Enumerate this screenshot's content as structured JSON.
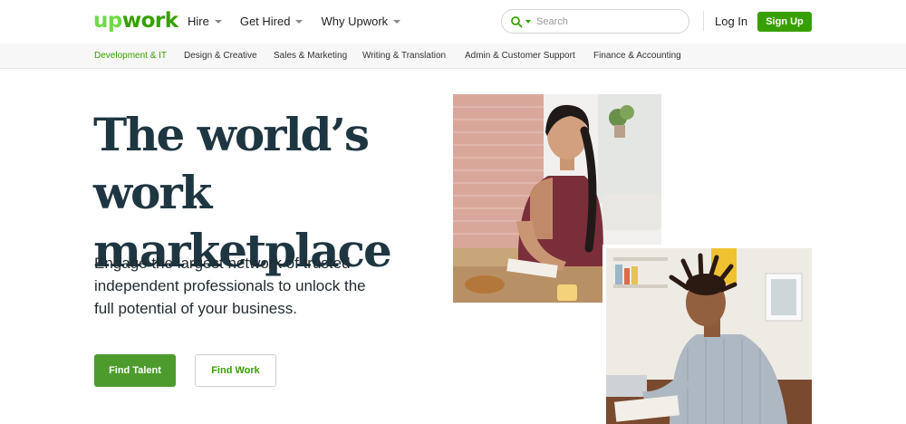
{
  "header": {
    "logo": {
      "prefix": "up",
      "rest": "work"
    },
    "nav": [
      {
        "label": "Hire"
      },
      {
        "label": "Get Hired"
      },
      {
        "label": "Why Upwork"
      }
    ],
    "search": {
      "placeholder": "Search",
      "icon": "search-icon"
    },
    "login_label": "Log In",
    "signup_label": "Sign Up"
  },
  "categories": [
    {
      "label": "Development & IT",
      "active": true
    },
    {
      "label": "Design & Creative"
    },
    {
      "label": "Sales & Marketing"
    },
    {
      "label": "Writing & Translation"
    },
    {
      "label": "Admin & Customer Support"
    },
    {
      "label": "Finance & Accounting"
    }
  ],
  "hero": {
    "title_line1": "The world’s work",
    "title_line2": "marketplace",
    "subtitle": "Engage the largest network of trusted independent professionals to unlock the full potential of your business.",
    "primary_button": "Find Talent",
    "secondary_button": "Find Work"
  },
  "colors": {
    "brand_green": "#37a000",
    "logo_light_green": "#6fda44",
    "title_navy": "#1e3642",
    "button_green": "#4d9b2d"
  }
}
